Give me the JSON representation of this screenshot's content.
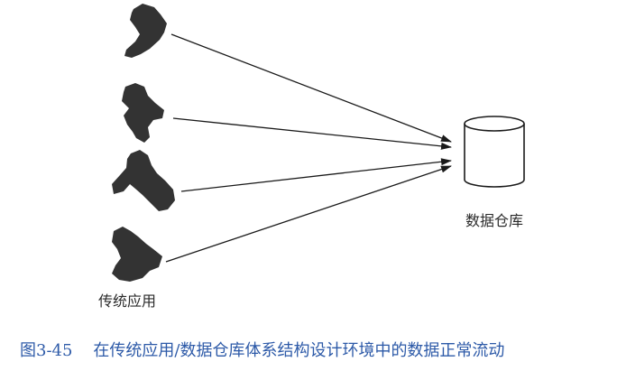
{
  "diagram": {
    "sources_label": "传统应用",
    "target_label": "数据仓库",
    "source_icon": "legacy-app-blob",
    "target_icon": "database-cylinder",
    "colors": {
      "blob_fill": "#3a3a3a",
      "line": "#1a1a1a",
      "caption": "#2d5aa8"
    }
  },
  "caption": {
    "figure_no": "图3-45",
    "text": "在传统应用/数据仓库体系结构设计环境中的数据正常流动"
  }
}
